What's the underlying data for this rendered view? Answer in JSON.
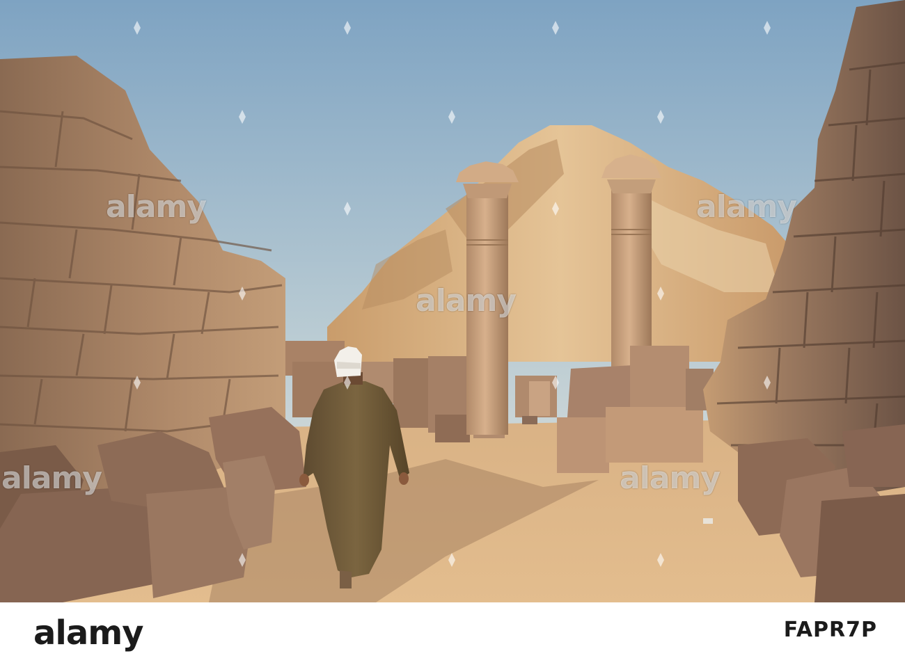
{
  "watermark": {
    "text": "alamy"
  },
  "footer": {
    "logo": "alamy",
    "label": "",
    "image_id": "FAPR7P"
  },
  "colors": {
    "sky_top": "#7fa4c3",
    "sky_bottom": "#dfe6e5",
    "sand": "#d7ad7c",
    "stone": "#c79a6e",
    "shadow_stone": "#7d5a45",
    "robe": "#6b5736"
  }
}
